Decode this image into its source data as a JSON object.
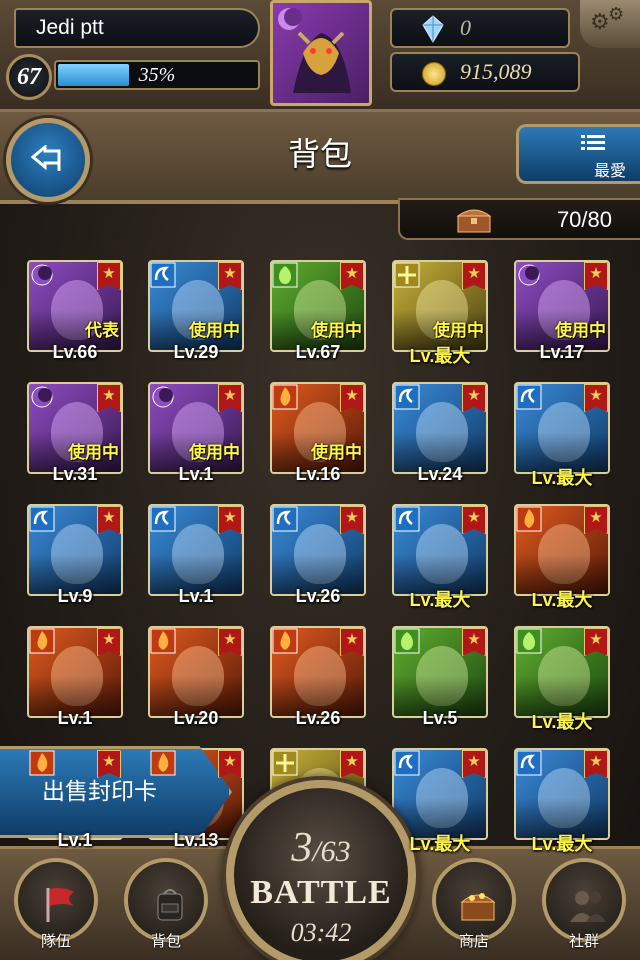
{
  "player": {
    "name": "Jedi ptt",
    "level": "67",
    "exp_label": "35%",
    "exp_fraction": 0.35,
    "gems": "0",
    "coins": "915,089"
  },
  "header": {
    "title": "背包",
    "favorites_label": "最愛",
    "capacity": "70/80"
  },
  "cards": [
    {
      "attr": "purple",
      "status": "代表",
      "level": "Lv.66"
    },
    {
      "attr": "blue",
      "status": "使用中",
      "level": "Lv.29"
    },
    {
      "attr": "green",
      "status": "使用中",
      "level": "Lv.67"
    },
    {
      "attr": "yellow",
      "status": "使用中",
      "level": "Lv.最大"
    },
    {
      "attr": "purple",
      "status": "使用中",
      "level": "Lv.17"
    },
    {
      "attr": "purple",
      "status": "使用中",
      "level": "Lv.31"
    },
    {
      "attr": "purple",
      "status": "使用中",
      "level": "Lv.1"
    },
    {
      "attr": "red",
      "status": "使用中",
      "level": "Lv.16"
    },
    {
      "attr": "blue",
      "status": "",
      "level": "Lv.24"
    },
    {
      "attr": "blue",
      "status": "",
      "level": "Lv.最大"
    },
    {
      "attr": "blue",
      "status": "",
      "level": "Lv.9"
    },
    {
      "attr": "blue",
      "status": "",
      "level": "Lv.1"
    },
    {
      "attr": "blue",
      "status": "",
      "level": "Lv.26"
    },
    {
      "attr": "blue",
      "status": "",
      "level": "Lv.最大"
    },
    {
      "attr": "red",
      "status": "",
      "level": "Lv.最大"
    },
    {
      "attr": "red",
      "status": "",
      "level": "Lv.1"
    },
    {
      "attr": "red",
      "status": "",
      "level": "Lv.20"
    },
    {
      "attr": "red",
      "status": "",
      "level": "Lv.26"
    },
    {
      "attr": "green",
      "status": "",
      "level": "Lv.5"
    },
    {
      "attr": "green",
      "status": "",
      "level": "Lv.最大"
    },
    {
      "attr": "red",
      "status": "",
      "level": "Lv.1"
    },
    {
      "attr": "red",
      "status": "",
      "level": "Lv.13"
    },
    {
      "attr": "yellow",
      "status": "",
      "level": ""
    },
    {
      "attr": "blue",
      "status": "",
      "level": "Lv.最大"
    },
    {
      "attr": "blue",
      "status": "",
      "level": "Lv.最大"
    }
  ],
  "sell_button": "出售封印卡",
  "battle": {
    "count": "3",
    "total": "/63",
    "label": "BATTLE",
    "timer": "03:42"
  },
  "nav": {
    "team": "隊伍",
    "bag": "背包",
    "shop": "商店",
    "social": "社群"
  }
}
